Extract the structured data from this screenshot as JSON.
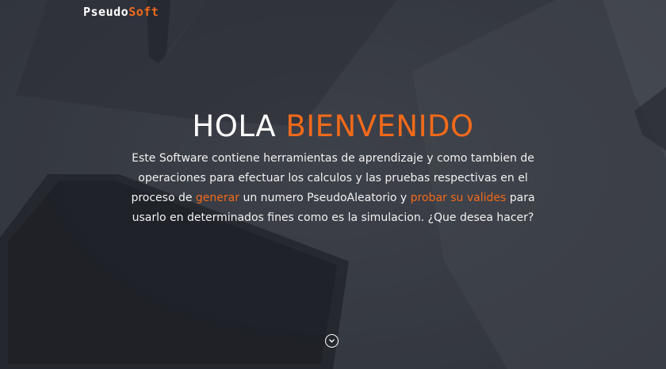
{
  "brand": {
    "name_part1": "Pseudo",
    "name_part2": "Soft"
  },
  "hero": {
    "title_part1": "HOLA ",
    "title_part2": "BIENVENIDO",
    "desc_part1": "Este Software contiene herramientas de aprendizaje y como tambien de operaciones para efectuar los calculos y las pruebas respectivas en el proceso de ",
    "link_generate": "generar",
    "desc_part2": " un numero PseudoAleatorio y ",
    "link_test": "probar su valides",
    "desc_part3": " para usarlo en determinados fines como es la simulacion. ¿Que desea hacer?"
  },
  "scroll_down": {
    "icon": "chevron-down-icon"
  },
  "colors": {
    "accent": "#f26a1b",
    "background": "#3c4048",
    "text": "#ffffff"
  }
}
